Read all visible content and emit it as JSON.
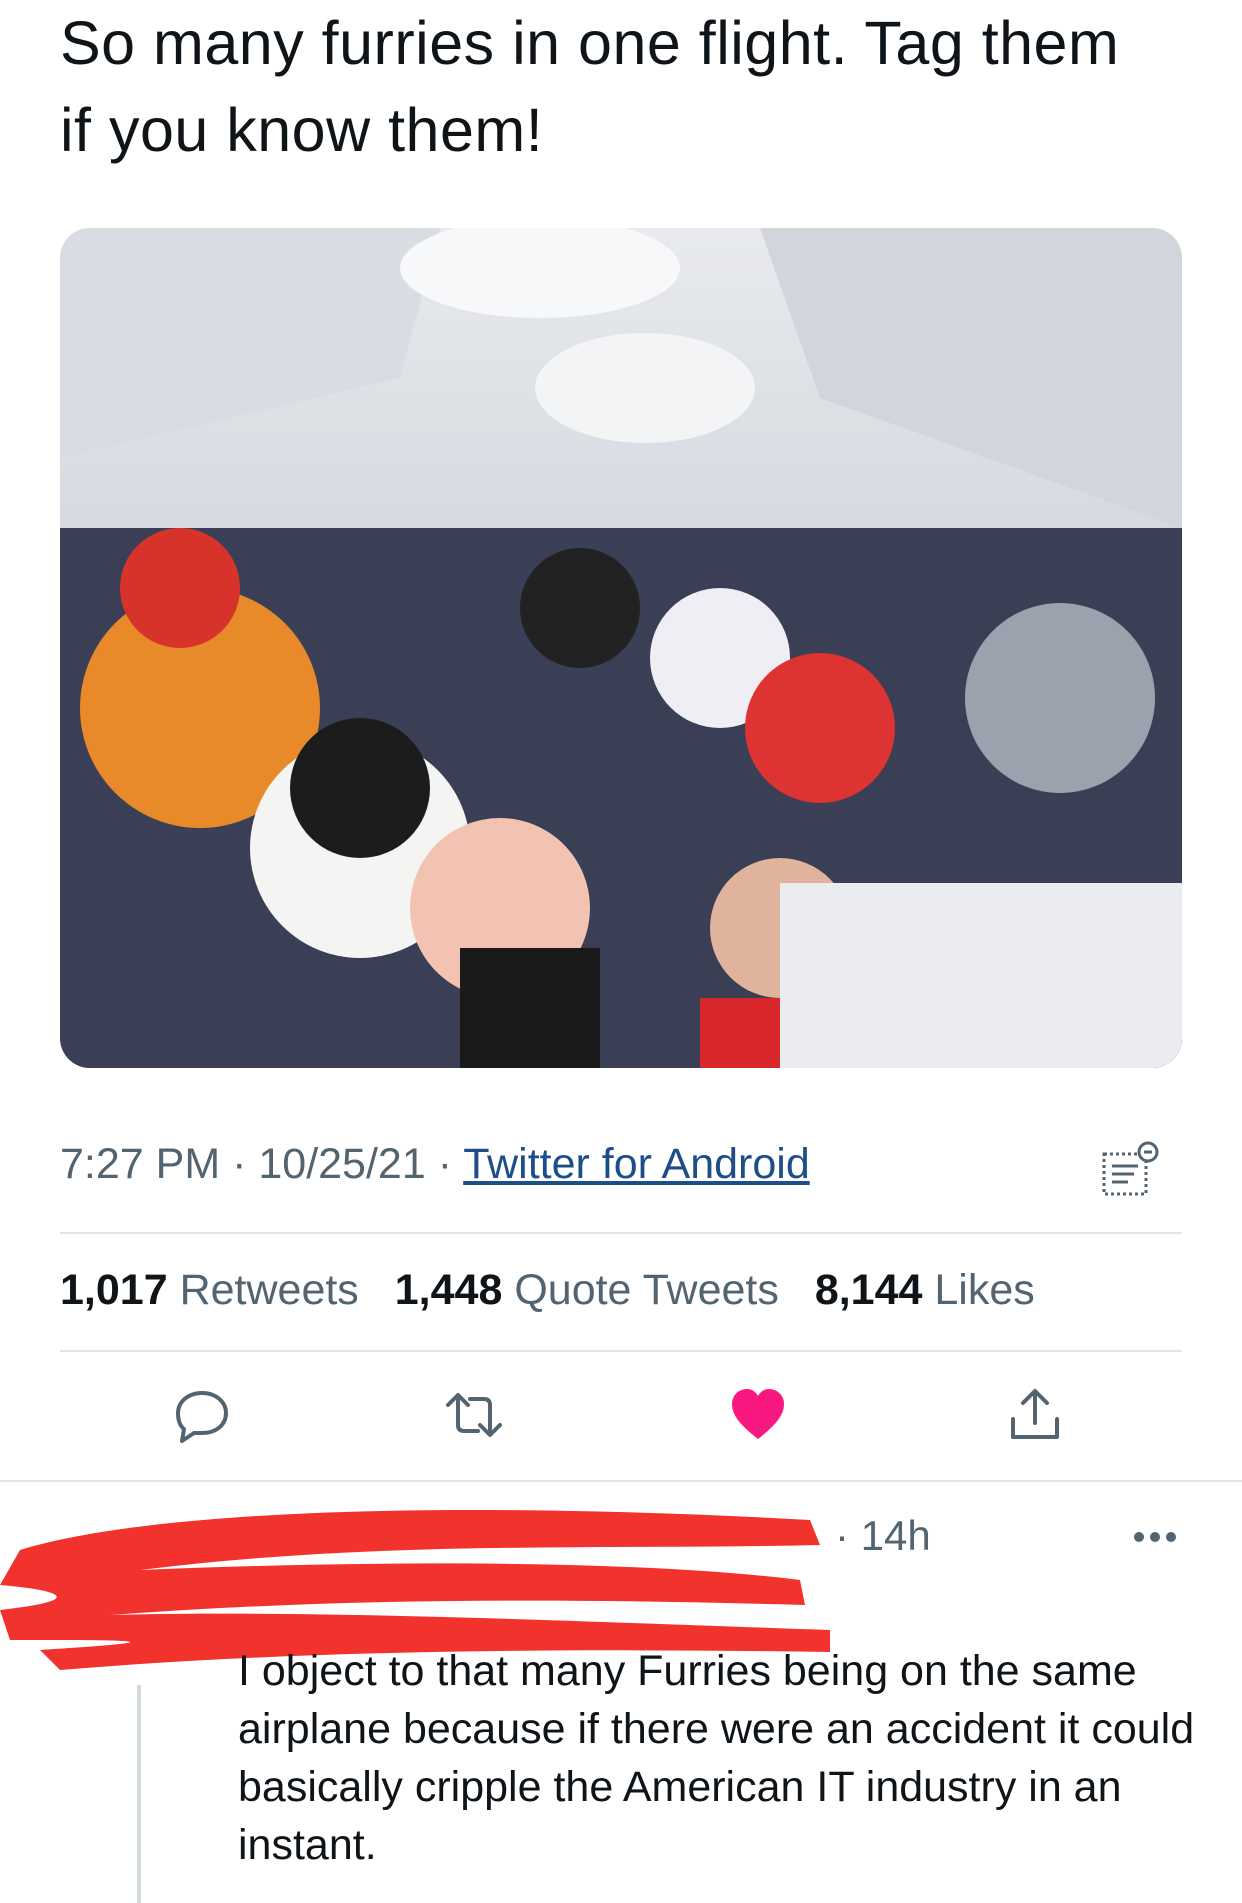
{
  "tweet": {
    "text": "So many furries in one flight. Tag them if you know them!",
    "time": "7:27 PM",
    "date": "10/25/21",
    "sep1": " · ",
    "sep2": " · ",
    "source": "Twitter for Android",
    "photo_alt": "photo"
  },
  "stats": {
    "retweets_count": "1,017",
    "retweets_label": "Retweets",
    "quotes_count": "1,448",
    "quotes_label": "Quote Tweets",
    "likes_count": "8,144",
    "likes_label": "Likes"
  },
  "actions": {
    "reply_icon": "reply-icon",
    "retweet_icon": "retweet-icon",
    "like_icon": "heart-icon",
    "share_icon": "share-icon",
    "like_color": "#f91880"
  },
  "reply": {
    "time": "· 14h",
    "text": "I object to that many Furries being on the same airplane because if there were an accident it could basically cripple the American IT industry in an instant.",
    "redaction_color": "#f2322c"
  }
}
